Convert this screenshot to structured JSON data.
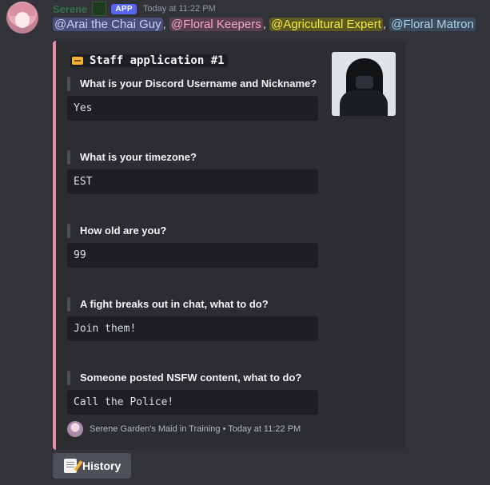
{
  "message": {
    "author": "Serene",
    "app_badge": "APP",
    "timestamp": "Today at 11:22 PM",
    "mentions": [
      "@Arai the Chai Guy",
      "@Floral Keepers",
      "@Agricultural Expert",
      "@Floral Matron"
    ],
    "separator": ","
  },
  "embed": {
    "accent_color": "#e88ca8",
    "title": "Staff application #1",
    "title_icon": "ticket-icon",
    "thumbnail": "hooded-figure-image",
    "fields": [
      {
        "name": "What is your Discord Username and Nickname?",
        "value": "Yes"
      },
      {
        "name": "What is your timezone?",
        "value": "EST"
      },
      {
        "name": "How old are you?",
        "value": "99"
      },
      {
        "name": "A fight breaks out in chat, what to do?",
        "value": "Join them!"
      },
      {
        "name": "Someone posted NSFW content, what to do?",
        "value": "Call the Police!"
      }
    ],
    "footer": {
      "text": "Serene Garden's Maid in Training • Today at 11:22 PM",
      "icon": "bot-avatar-icon"
    }
  },
  "buttons": {
    "history_label": "History",
    "history_icon": "memo-icon"
  }
}
